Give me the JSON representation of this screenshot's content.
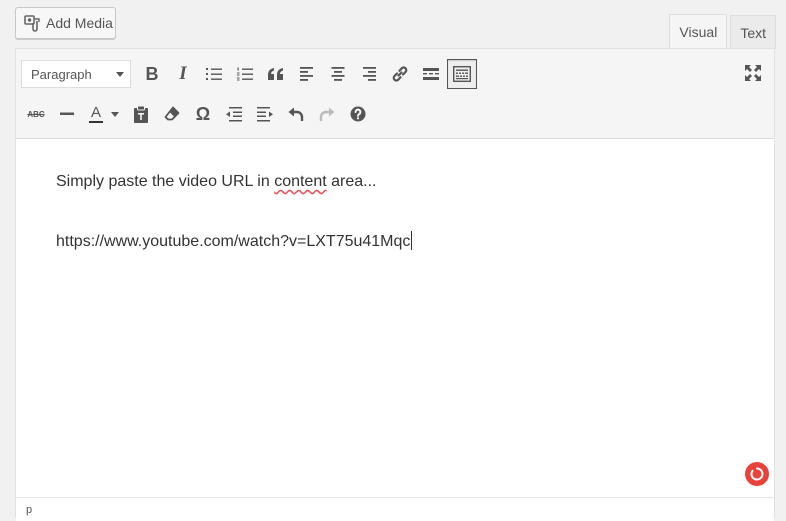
{
  "media": {
    "add_label": "Add Media",
    "icon": "media-camera-icon"
  },
  "tabs": [
    {
      "label": "Visual",
      "active": true
    },
    {
      "label": "Text",
      "active": false
    }
  ],
  "toolbar": {
    "format_select": "Paragraph",
    "row1_buttons": [
      "bold-icon",
      "italic-icon",
      "bullet-list-icon",
      "numbered-list-icon",
      "blockquote-icon",
      "align-left-icon",
      "align-center-icon",
      "align-right-icon",
      "link-icon",
      "read-more-icon",
      "toolbar-toggle-icon"
    ],
    "row2_buttons": [
      "strikethrough-icon",
      "horizontal-line-icon",
      "text-color-icon",
      "paste-text-icon",
      "clear-formatting-icon",
      "special-character-icon",
      "outdent-icon",
      "indent-icon",
      "undo-icon",
      "redo-icon",
      "help-icon"
    ],
    "bold": "B",
    "italic": "I",
    "strike": "ABC",
    "text_color": "A",
    "special_char": "Ω"
  },
  "content": {
    "line1_before": "Simply paste the video URL in ",
    "line1_misspelled": "content",
    "line1_after": " area...",
    "line2": "https://www.youtube.com/watch?v=LXT75u41Mqc"
  },
  "status": {
    "path": "p"
  },
  "colors": {
    "accent": "#e8433a",
    "spell_underline": "#e8545f",
    "icon": "#555555"
  }
}
